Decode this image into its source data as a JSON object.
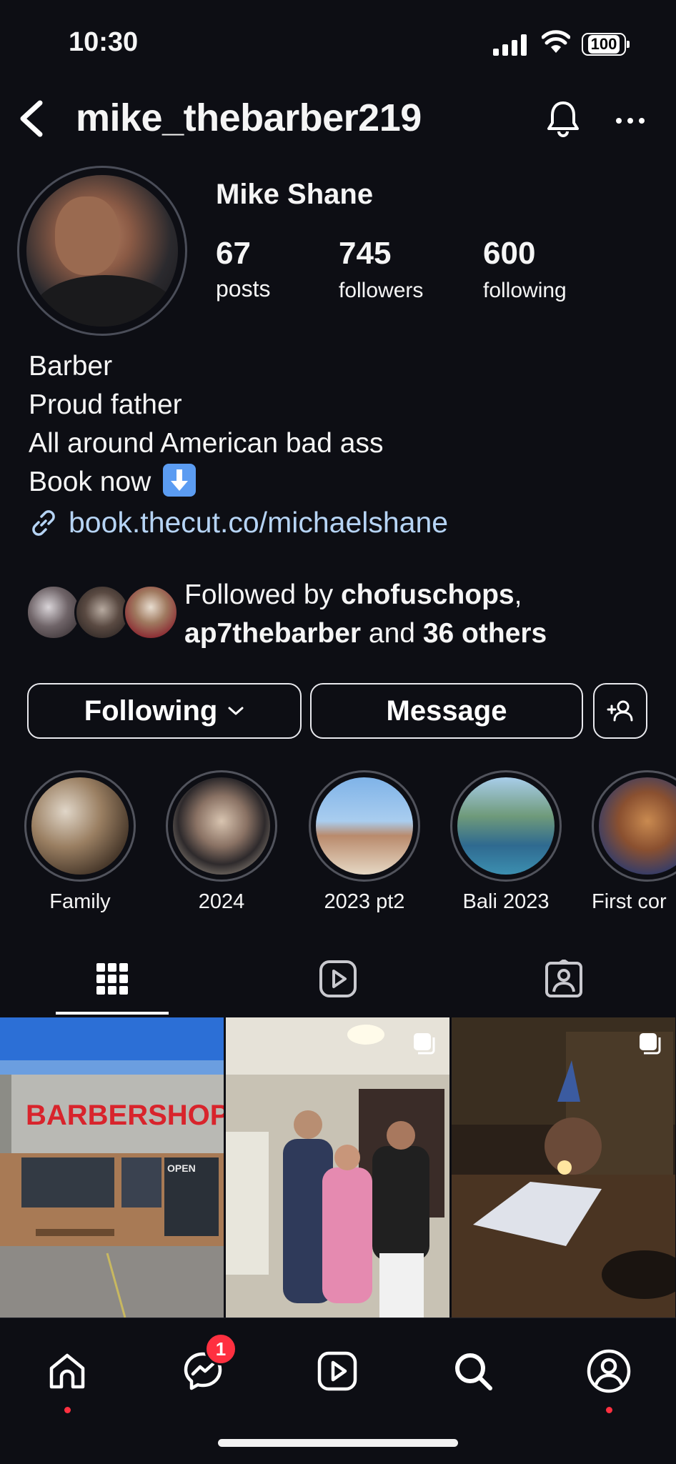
{
  "status_bar": {
    "time": "10:30",
    "battery": "100"
  },
  "header": {
    "username": "mike_thebarber219"
  },
  "profile": {
    "name": "Mike Shane",
    "stats": [
      {
        "value": "67",
        "label": "posts"
      },
      {
        "value": "745",
        "label": "followers"
      },
      {
        "value": "600",
        "label": "following"
      }
    ],
    "bio": [
      "Barber",
      "Proud father",
      "All around American bad ass",
      "Book now"
    ],
    "link": "book.thecut.co/michaelshane"
  },
  "mutual": {
    "prefix": "Followed by ",
    "user1": "chofuschops",
    "sep": ",",
    "user2": "ap7thebarber",
    "and": " and ",
    "others": "36 others"
  },
  "actions": {
    "following": "Following",
    "message": "Message"
  },
  "highlights": [
    {
      "label": "Family"
    },
    {
      "label": "2024"
    },
    {
      "label": "2023 pt2"
    },
    {
      "label": "Bali 2023"
    },
    {
      "label": "First cor"
    }
  ],
  "grid": {
    "post1_sign": "BARBERSHOP",
    "post1_door": "OPEN"
  },
  "nav": {
    "messages_badge": "1"
  },
  "colors": {
    "background": "#0d0e14",
    "link": "#b6d4f5",
    "badge": "#ff3040"
  }
}
